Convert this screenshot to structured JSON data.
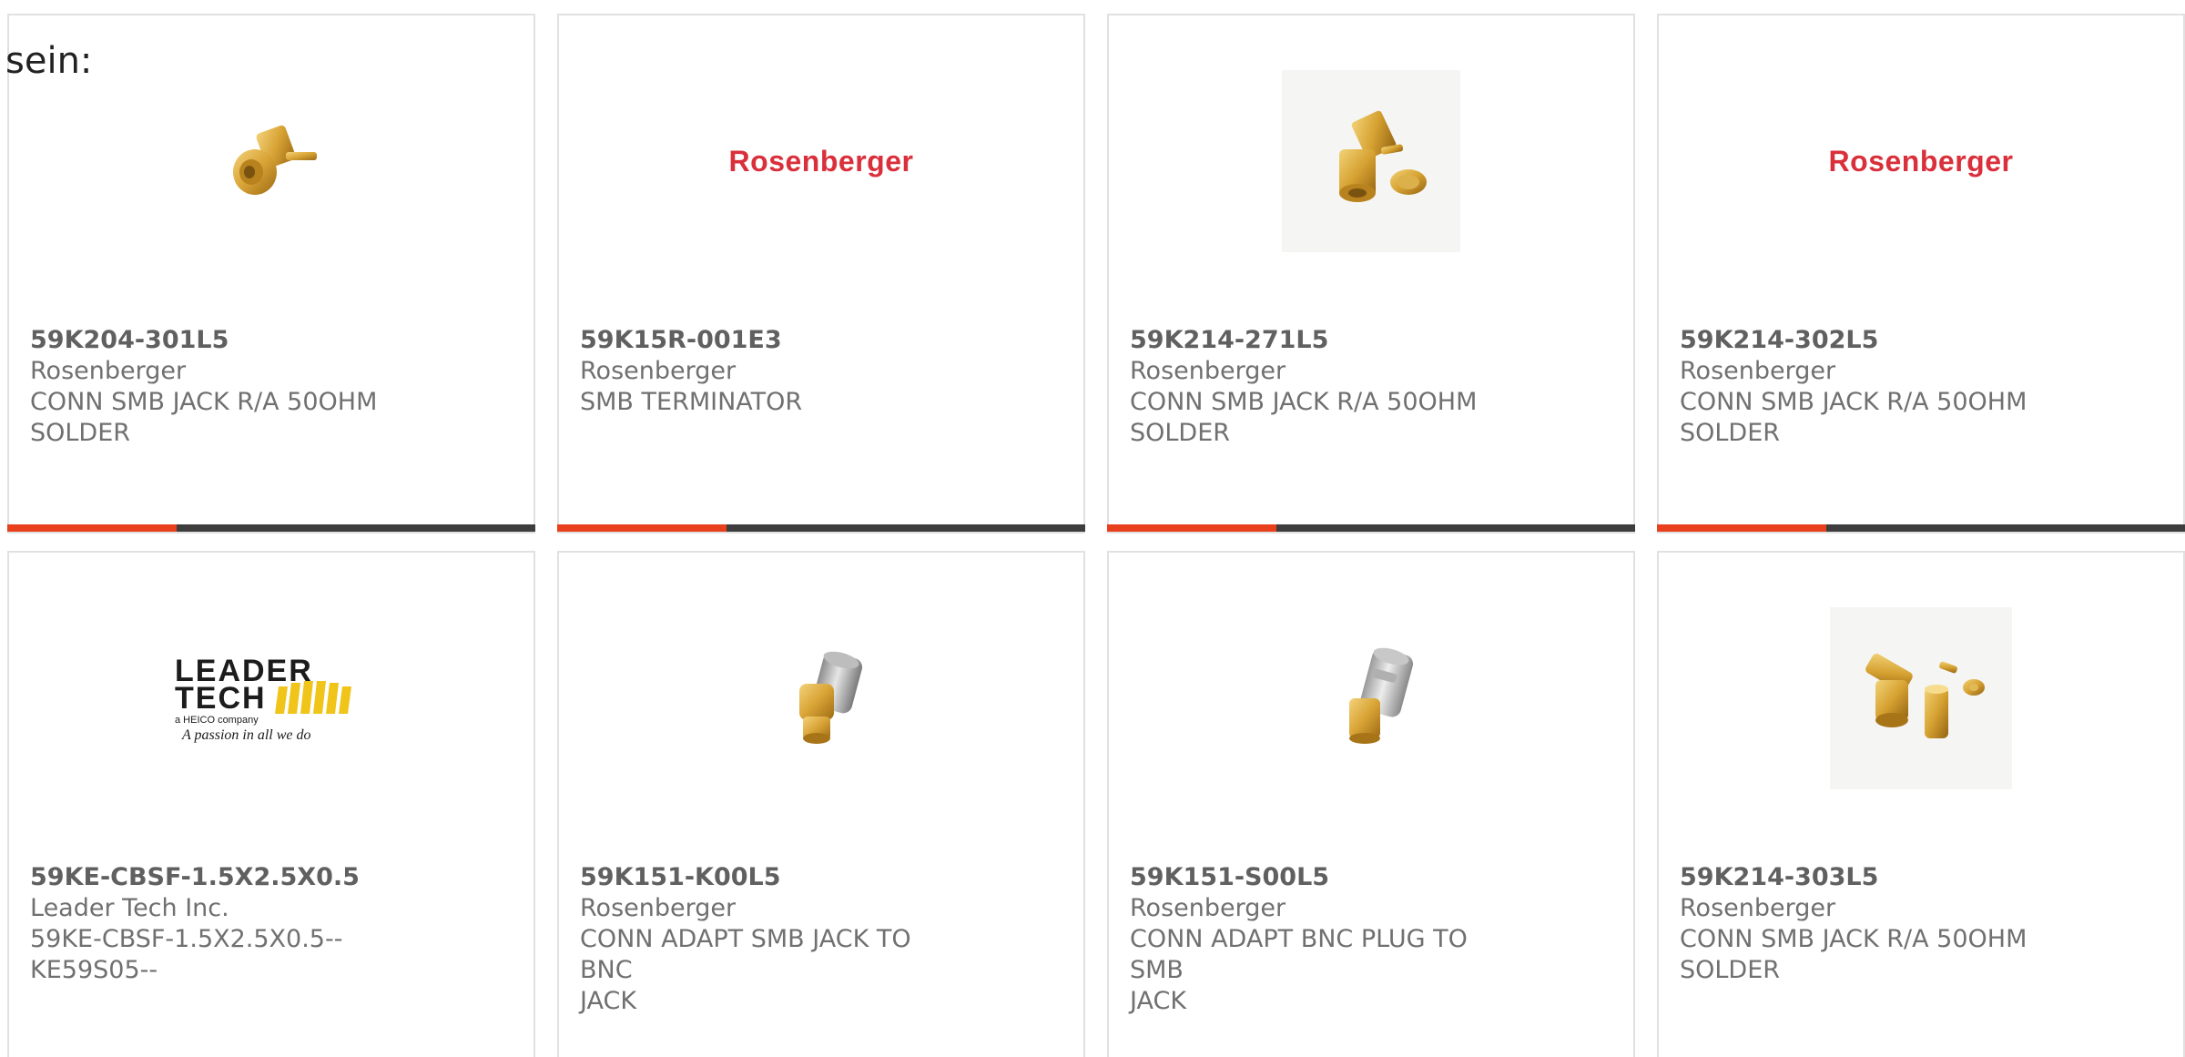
{
  "prefix_text": "sein:",
  "colors": {
    "accent": "#e8401c",
    "bar_track": "#3d3d3d",
    "card_border": "#e1e1e1",
    "logo_red": "#d9303b"
  },
  "products": [
    {
      "part_number": "59K204-301L5",
      "manufacturer": "Rosenberger",
      "description_line1": "CONN SMB JACK R/A 50OHM",
      "description_line2": "SOLDER",
      "image_icon": "smb-right-angle-connector-icon",
      "progress": 0.32
    },
    {
      "part_number": "59K15R-001E3",
      "manufacturer": "Rosenberger",
      "description_line1": "SMB TERMINATOR",
      "description_line2": "",
      "logo_text": "Rosenberger",
      "progress": 0.32
    },
    {
      "part_number": "59K214-271L5",
      "manufacturer": "Rosenberger",
      "description_line1": "CONN SMB JACK R/A 50OHM",
      "description_line2": "SOLDER",
      "image_icon": "smb-right-angle-connector-with-washer-icon",
      "progress": 0.32
    },
    {
      "part_number": "59K214-302L5",
      "manufacturer": "Rosenberger",
      "description_line1": "CONN SMB JACK R/A 50OHM",
      "description_line2": "SOLDER",
      "logo_text": "Rosenberger",
      "progress": 0.32
    },
    {
      "part_number": "59KE-CBSF-1.5X2.5X0.5",
      "manufacturer": "Leader Tech Inc.",
      "description_line1": "59KE-CBSF-1.5X2.5X0.5--",
      "description_line2": "KE59S05--",
      "logo_line1": "LEADER",
      "logo_line2": "TECH",
      "logo_sub": "a HEICO company",
      "logo_tagline": "A passion in all we do"
    },
    {
      "part_number": "59K151-K00L5",
      "manufacturer": "Rosenberger",
      "description_line1": "CONN ADAPT SMB JACK TO BNC",
      "description_line2": "JACK",
      "image_icon": "smb-to-bnc-adapter-icon"
    },
    {
      "part_number": "59K151-S00L5",
      "manufacturer": "Rosenberger",
      "description_line1": "CONN ADAPT BNC PLUG TO SMB",
      "description_line2": "JACK",
      "image_icon": "bnc-to-smb-adapter-icon"
    },
    {
      "part_number": "59K214-303L5",
      "manufacturer": "Rosenberger",
      "description_line1": "CONN SMB JACK R/A 50OHM",
      "description_line2": "SOLDER",
      "image_icon": "smb-right-angle-crimp-kit-icon"
    }
  ]
}
